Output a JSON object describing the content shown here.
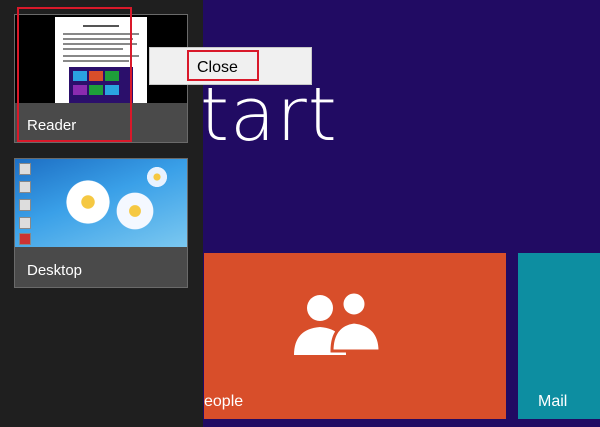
{
  "start": {
    "title": "tart"
  },
  "tiles": {
    "people": {
      "label": "eople",
      "icon": "people-icon",
      "color": "#d84e2a"
    },
    "mail": {
      "label": "Mail",
      "color": "#0d8ea1"
    }
  },
  "switcher": {
    "apps": [
      {
        "label": "Reader"
      },
      {
        "label": "Desktop"
      }
    ]
  },
  "context_menu": {
    "items": [
      {
        "label": "Close"
      }
    ]
  },
  "colors": {
    "start_background": "#210b63",
    "highlight": "#d9192a"
  }
}
